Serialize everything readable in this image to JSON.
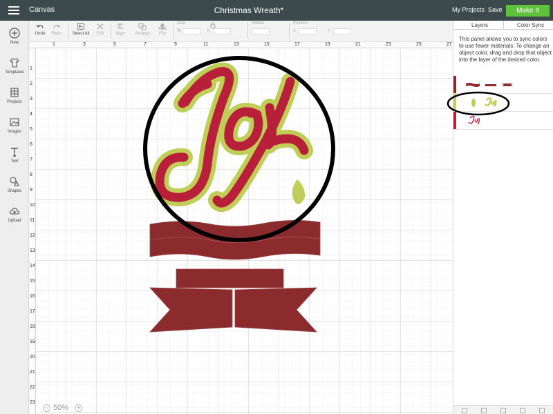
{
  "header": {
    "menu_icon": "hamburger-menu-icon",
    "app_title": "Canvas",
    "doc_title": "Christmas Wreath*",
    "my_projects": "My Projects",
    "save": "Save",
    "make_it": "Make It",
    "make_it_color": "#5ec23a",
    "bar_color": "#3c4a4d"
  },
  "sidebar": {
    "items": [
      {
        "label": "New",
        "icon": "plus-circle-icon"
      },
      {
        "label": "Templates",
        "icon": "tshirt-icon"
      },
      {
        "label": "Projects",
        "icon": "grid-book-icon"
      },
      {
        "label": "Images",
        "icon": "image-icon"
      },
      {
        "label": "Text",
        "icon": "text-t-icon"
      },
      {
        "label": "Shapes",
        "icon": "shapes-icon"
      },
      {
        "label": "Upload",
        "icon": "cloud-upload-icon"
      }
    ]
  },
  "toolbar": {
    "undo": "Undo",
    "redo": "Redo",
    "select_all": "Select All",
    "edit": "Edit",
    "align": "Align",
    "arrange": "Arrange",
    "flip": "Flip",
    "size": "Size",
    "w": "W",
    "h": "H",
    "rotate": "Rotate",
    "position": "Position",
    "x": "X",
    "y": "Y"
  },
  "ruler": {
    "top": [
      "1",
      "3",
      "5",
      "7",
      "9",
      "11",
      "13",
      "15",
      "17",
      "19",
      "21",
      "23",
      "25",
      "27"
    ],
    "left": [
      "1",
      "2",
      "3",
      "4",
      "5",
      "6",
      "7",
      "8",
      "9",
      "10",
      "11",
      "12",
      "13",
      "14",
      "15",
      "16",
      "17",
      "18",
      "19",
      "20",
      "21",
      "22",
      "23"
    ]
  },
  "zoom": {
    "minus": "−",
    "value": "50%",
    "plus": "+"
  },
  "panel": {
    "tabs": [
      "Layers",
      "Color Sync"
    ],
    "description": "This panel allows you to sync colors to use fewer materials. To change an object color, drag and drop that object into the layer of the desired color.",
    "colors": {
      "red": "#8b2b2e",
      "crimson": "#b8203a",
      "green": "#c0cd57"
    }
  },
  "artwork": {
    "word": "Joy"
  }
}
